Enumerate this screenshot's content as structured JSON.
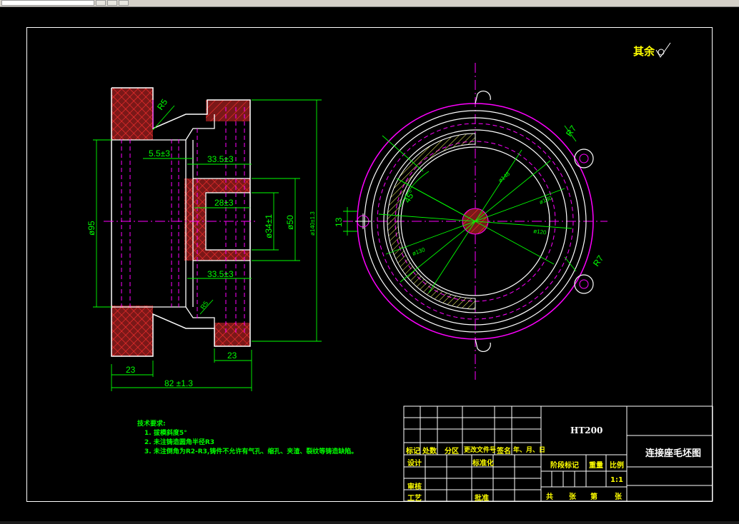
{
  "finish_note": "其余",
  "tech_requirements": {
    "title": "技术要求:",
    "items": [
      "1. 拔模斜度5°",
      "2. 未注铸造圆角半径R3",
      "3. 未注倒角为R2-R3,铸件不允许有气孔、缩孔、夹渣、裂纹等铸造缺陷。"
    ]
  },
  "dimensions": {
    "radius_top": "R5",
    "radius_bottom": "R5",
    "inner_depth": "5.5±3",
    "bore_depth_top": "33.5±3",
    "bore_depth_mid": "28±3",
    "bore_depth_bot": "33.5±3",
    "dia_95": "ø95",
    "dia_34": "ø34±1",
    "dia_50": "ø50",
    "dia_140": "ø140±1.3",
    "width_left": "23",
    "width_right": "23",
    "total_length": "82 ±1.3",
    "angle": "45°",
    "height_13": "13",
    "r7_top": "R7",
    "r7_bottom": "R7",
    "circle_d1": "ø148",
    "circle_d2": "ø130",
    "circle_d3": "ø120",
    "circle_d4": "ø130"
  },
  "title_block": {
    "material": "HT200",
    "part_name": "连接座毛坯图",
    "scale": "1:1",
    "labels": {
      "mark": "标记",
      "count": "处数",
      "zone": "分区",
      "doc_no": "更改文件号",
      "sign": "签名",
      "date": "年、月、日",
      "design": "设计",
      "standard": "标准化",
      "stage": "阶段标记",
      "weight": "重量",
      "ratio": "比例",
      "review": "审核",
      "process": "工艺",
      "approve": "批准",
      "total": "共",
      "sheets": "张",
      "no": "第",
      "sheet": "张"
    }
  }
}
